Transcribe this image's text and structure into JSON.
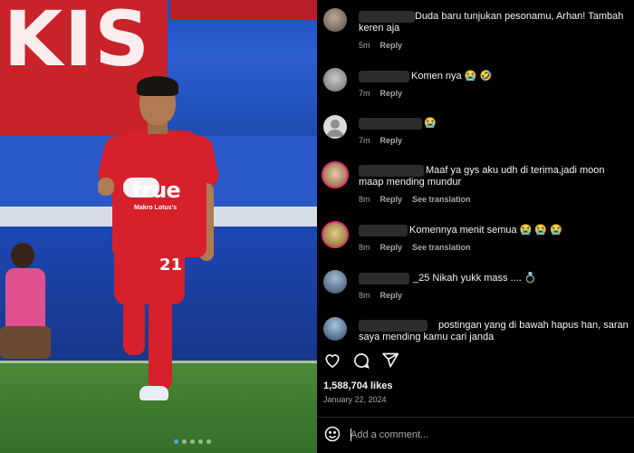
{
  "post": {
    "carousel_count": 5,
    "carousel_active_index": 0,
    "banner_text": "KIS",
    "jersey_brand": "true",
    "jersey_sponsor": "Makro  Lotus's",
    "jersey_number": "21"
  },
  "comments": [
    {
      "text": "Duda baru tunjukan pesonamu, Arhan! Tambah keren aja",
      "time": "5m",
      "reply": "Reply",
      "translate": ""
    },
    {
      "text": "Komen nya 😭 🤣",
      "time": "7m",
      "reply": "Reply",
      "translate": ""
    },
    {
      "text": "😭",
      "time": "7m",
      "reply": "Reply",
      "translate": ""
    },
    {
      "text": "Maaf ya gys aku udh di terima,jadi moon maap mending mundur",
      "time": "8m",
      "reply": "Reply",
      "translate": "See translation"
    },
    {
      "text": "Komennya menit semua 😭 😭 😭",
      "time": "8m",
      "reply": "Reply",
      "translate": "See translation"
    },
    {
      "text": "_25 Nikah yukk mass .... 💍",
      "time": "8m",
      "reply": "Reply",
      "translate": ""
    },
    {
      "text": "postingan yang di bawah hapus han, saran saya mending kamu cari janda",
      "time": "",
      "reply": "",
      "translate": ""
    }
  ],
  "actions": {
    "like_icon": "heart-icon",
    "comment_icon": "comment-icon",
    "share_icon": "send-icon"
  },
  "likes": "1,588,704 likes",
  "date": "January 22, 2024",
  "add_comment": {
    "placeholder": "Add a comment...",
    "emoji_icon": "emoji-icon"
  },
  "colors": {
    "background": "#000000",
    "text": "#f5f5f5",
    "muted": "#a8a8a8",
    "jersey_red": "#d6202b",
    "stadium_blue": "#2a58c7"
  }
}
